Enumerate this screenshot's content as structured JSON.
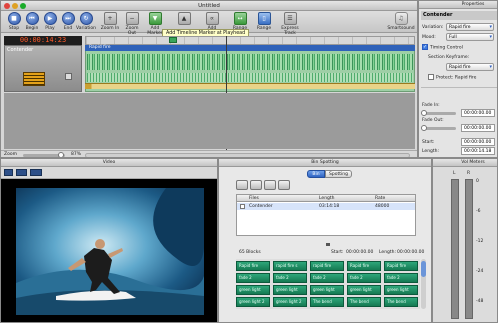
{
  "main_window": {
    "title": "Untitled",
    "timecode": "00:00:14:23",
    "toolbar": [
      {
        "label": "Stop",
        "icon": "stop-icon"
      },
      {
        "label": "Begin",
        "icon": "rewind-begin-icon"
      },
      {
        "label": "Play",
        "icon": "play-icon"
      },
      {
        "label": "End",
        "icon": "fast-forward-end-icon"
      },
      {
        "label": "Variation",
        "icon": "variation-icon"
      },
      {
        "label": "Zoom In",
        "icon": "zoom-in-icon"
      },
      {
        "label": "Zoom Out",
        "icon": "zoom-out-icon"
      },
      {
        "label": "Add Marker",
        "icon": "add-marker-icon"
      },
      {
        "label": "Add Hit Marker",
        "icon": "add-hit-marker-icon"
      },
      {
        "label": "Add Tempo",
        "icon": "add-tempo-icon"
      },
      {
        "label": "Range Extend",
        "icon": "range-extend-icon"
      },
      {
        "label": "Range",
        "icon": "range-icon"
      },
      {
        "label": "Express Track",
        "icon": "express-track-icon"
      },
      {
        "label": "Smartsound",
        "icon": "smartsound-icon"
      }
    ],
    "tooltip": "Add Timeline Marker at Playhead",
    "track_name": "Contender",
    "clip_label": "Rapid fire",
    "zoom_label": "Zoom",
    "zoom_value": "87%"
  },
  "properties": {
    "title": "Properties",
    "header": "Contender",
    "variation_label": "Variation:",
    "variation_value": "Rapid fire",
    "mood_label": "Mood:",
    "mood_value": "Full",
    "timing_control_label": "Timing Control",
    "timing_control_checked": true,
    "section_keyframe_label": "Section Keyframe:",
    "section_keyframe_value": "Rapid fire",
    "protect_label": "Protect: Rapid fire",
    "protect_checked": false,
    "fade_in_label": "Fade In:",
    "fade_in_value": "00:00:00.00",
    "fade_out_label": "Fade Out:",
    "fade_out_value": "00:00:00.00",
    "start_label": "Start:",
    "start_value": "00:00:00.00",
    "length_label": "Length:",
    "length_value": "00:00:14.18"
  },
  "video": {
    "title": "Video"
  },
  "bin": {
    "title": "Bin Spotting",
    "tab_bin": "Bin",
    "tab_spotting": "Spotting",
    "columns": [
      "Files",
      "Length",
      "Rate"
    ],
    "rows": [
      {
        "name": "Contender",
        "length": "03:14:18",
        "rate": "48000"
      }
    ],
    "blocks_label": "65 Blocks",
    "start_label": "Start:",
    "start_value": "00:00:00.00",
    "length_label": "Length:",
    "length_value": "00:00:00.00",
    "tiles": [
      [
        "Rapid fire",
        "rapid fire s",
        "rapid fire",
        "Rapid fire",
        "Rapid fire"
      ],
      [
        "fade 2",
        "fade 2",
        "fade 2",
        "fade 2",
        "fade 2"
      ],
      [
        "green light",
        "green light",
        "green light",
        "green light",
        "green light"
      ],
      [
        "green light 2",
        "green light 2",
        "The bend",
        "The bend",
        "The bend"
      ]
    ]
  },
  "meters": {
    "title": "Vol Meters",
    "left_label": "L",
    "right_label": "R",
    "scale": [
      "0",
      "-6",
      "-12",
      "-24",
      "-48"
    ]
  },
  "colors": {
    "timecode_bg": "#1e1e1e",
    "timecode_fg": "#ff5a2a",
    "tile_green": "#1f8a62",
    "selection_blue": "#3c7be0",
    "waveform_green": "#7fd28e"
  }
}
